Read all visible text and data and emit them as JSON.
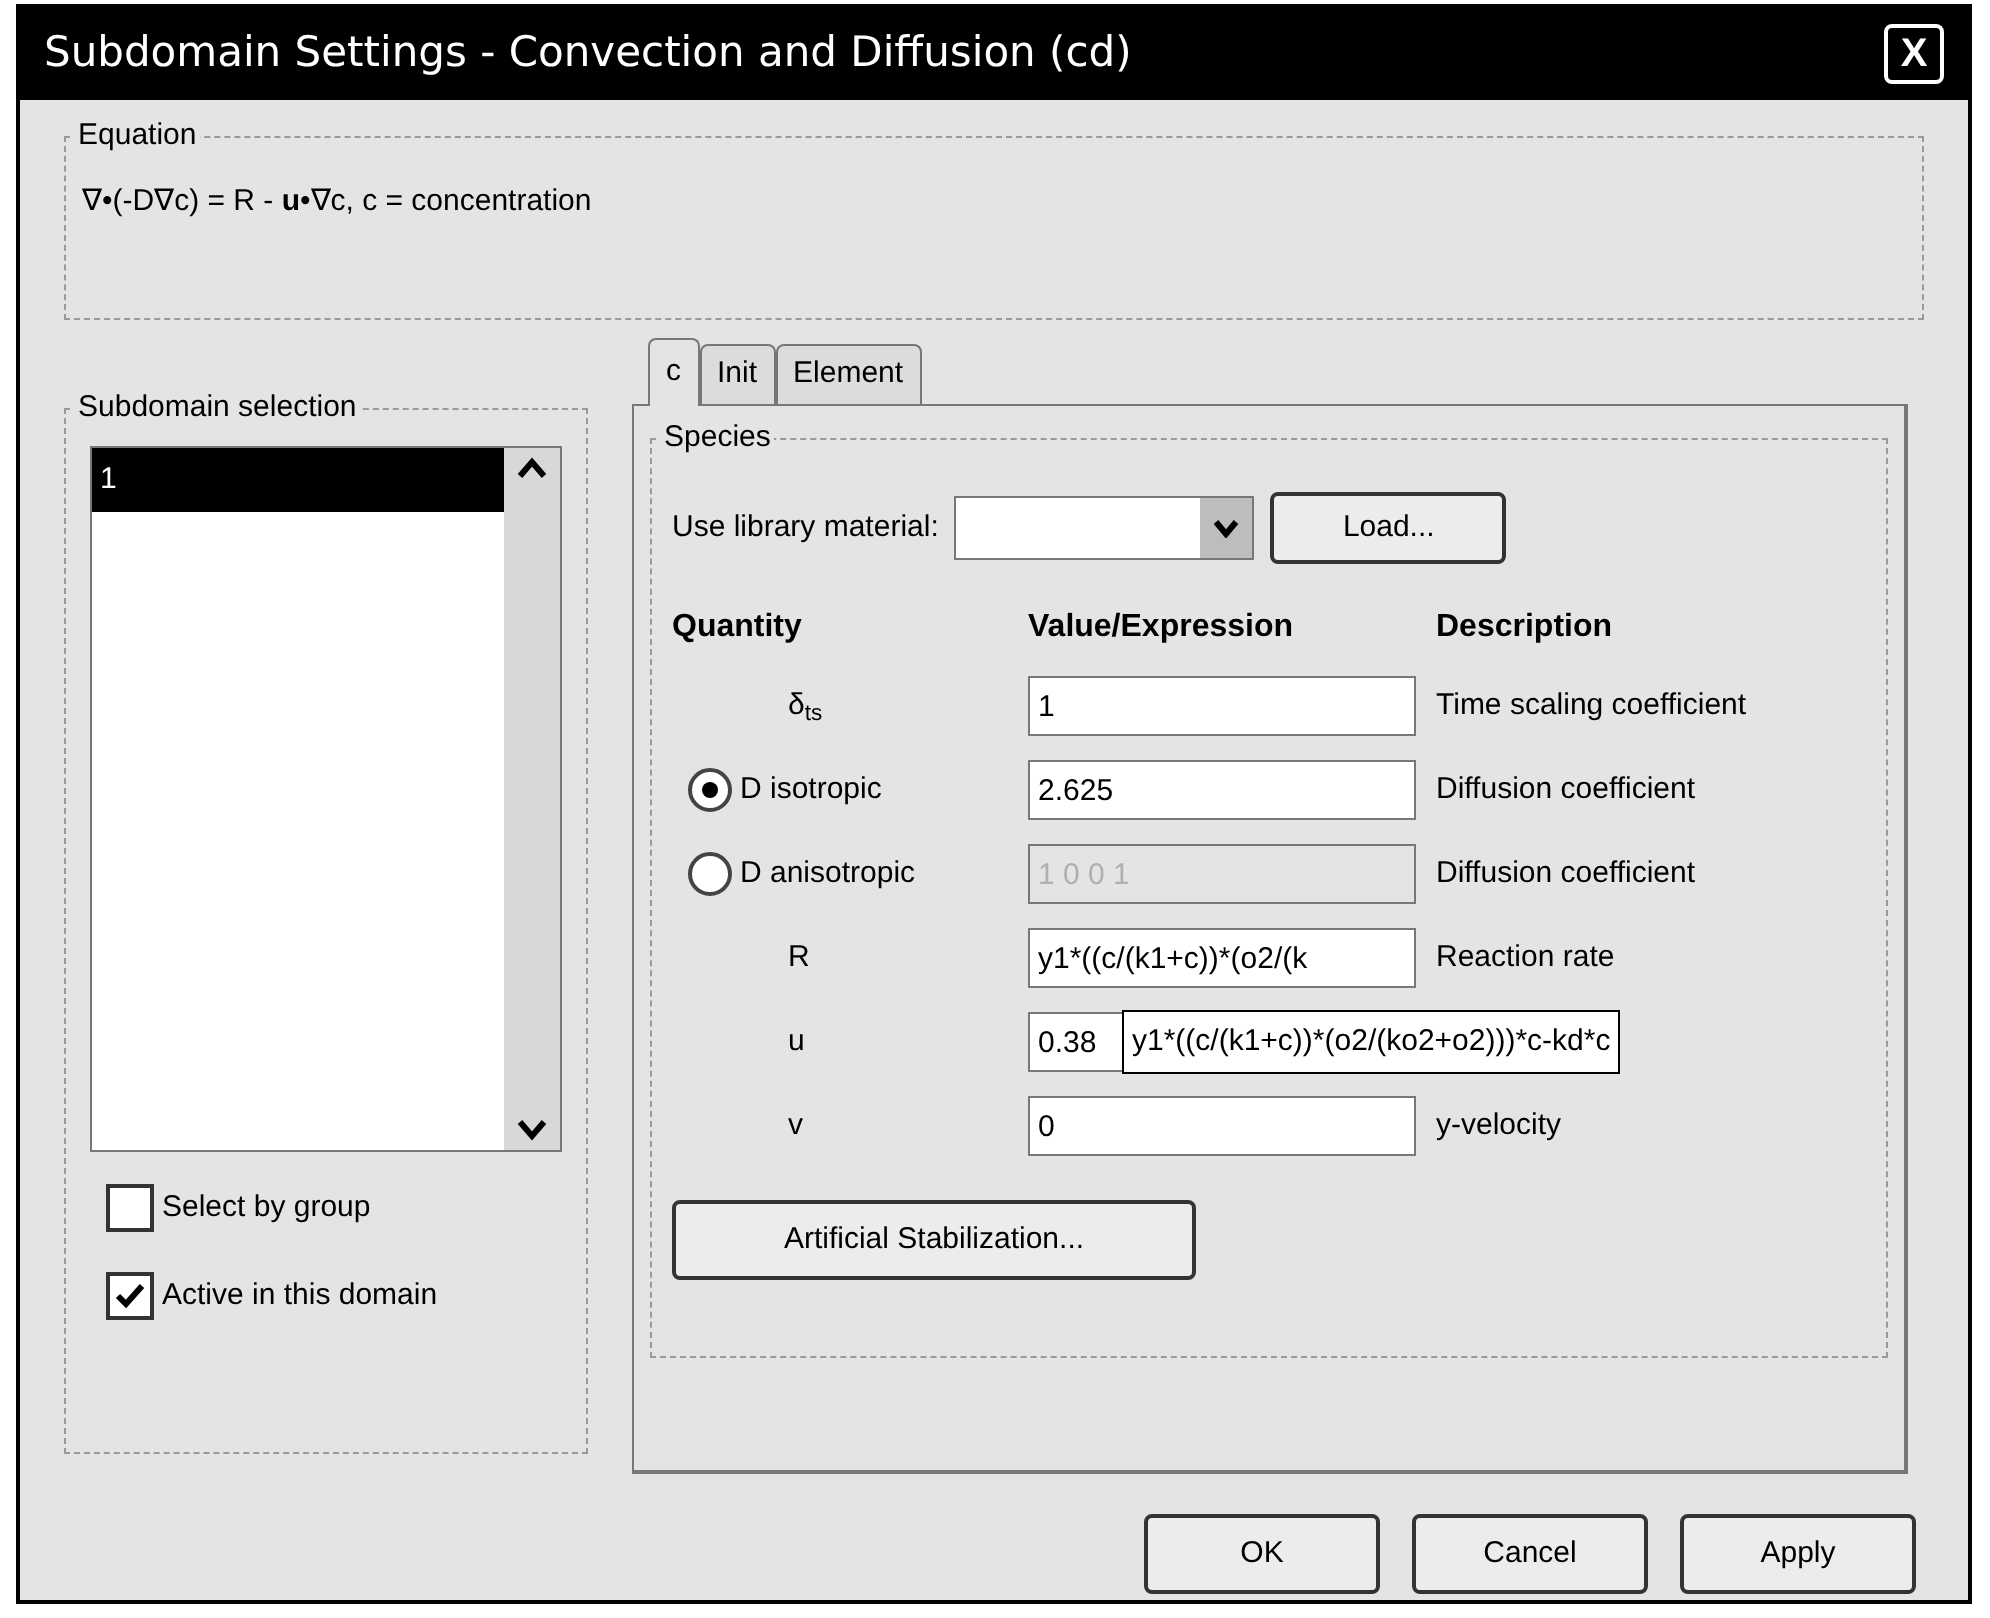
{
  "window": {
    "title": "Subdomain Settings - Convection and Diffusion (cd)",
    "close": "X"
  },
  "equation": {
    "label": "Equation",
    "text": "∇•(-D∇c) = R - **u**•∇c, c = concentration"
  },
  "subdomain_selection": {
    "label": "Subdomain selection",
    "items": [
      {
        "label": "1",
        "selected": true
      }
    ],
    "checkboxes": [
      {
        "label": "Select by group",
        "checked": false
      },
      {
        "label": "Active in this domain",
        "checked": true
      }
    ]
  },
  "tabs": [
    {
      "label": "c",
      "selected": true
    },
    {
      "label": "Init",
      "selected": false
    },
    {
      "label": "Element",
      "selected": false
    }
  ],
  "species": {
    "label": "Species",
    "library_label": "Use library material:",
    "load_button": "Load...",
    "columns": [
      "Quantity",
      "Value/Expression",
      "Description"
    ],
    "rows": [
      {
        "kind": "label",
        "quantity": "δ$_{ts}$",
        "value": "1",
        "description": "Time scaling coefficient",
        "disabled": false
      },
      {
        "kind": "radio",
        "quantity": "D isotropic",
        "selected": true,
        "value": "2.625",
        "description": "Diffusion coefficient",
        "disabled": false
      },
      {
        "kind": "radio",
        "quantity": "D anisotropic",
        "selected": false,
        "value": "1 0 0 1",
        "description": "Diffusion coefficient",
        "disabled": true
      },
      {
        "kind": "label",
        "quantity": "R",
        "value": "y1*((c/(k1+c))*(o2/(k",
        "description": "Reaction rate",
        "disabled": false
      },
      {
        "kind": "label",
        "quantity": "u",
        "value": "0.38",
        "disabled": false
      },
      {
        "kind": "label",
        "quantity": "v",
        "value": "0",
        "description": "y-velocity",
        "disabled": false
      }
    ],
    "tooltip": "y1*((c/(k1+c))*(o2/(ko2+o2)))*c-kd*c",
    "stabilization_button": "Artificial Stabilization..."
  },
  "buttons": [
    "OK",
    "Cancel",
    "Apply"
  ]
}
